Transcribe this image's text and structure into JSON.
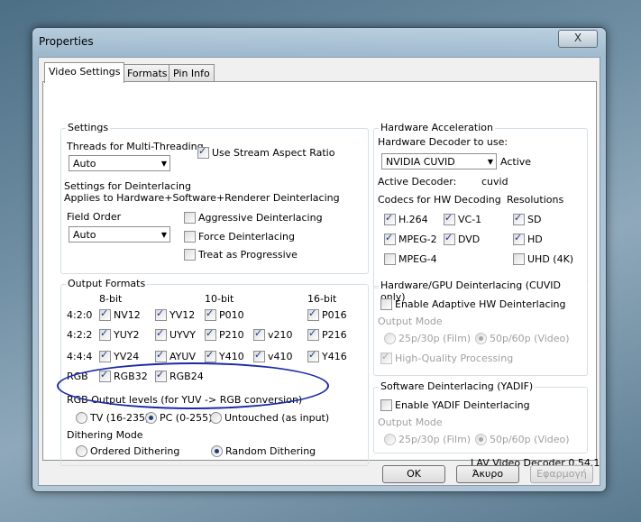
{
  "window": {
    "title": "Properties",
    "close": "X"
  },
  "tabs": [
    "Video Settings",
    "Formats",
    "Pin Info"
  ],
  "settings": {
    "group": "Settings",
    "threads_label": "Threads for Multi-Threading",
    "threads_value": "Auto",
    "stream_aspect": "Use Stream Aspect Ratio",
    "deint_label": "Settings for Deinterlacing",
    "deint_applies": "Applies to Hardware+Software+Renderer Deinterlacing",
    "field_order_label": "Field Order",
    "field_order_value": "Auto",
    "aggressive": "Aggressive Deinterlacing",
    "force": "Force Deinterlacing",
    "progressive": "Treat as Progressive"
  },
  "output": {
    "group": "Output Formats",
    "headers": [
      "8-bit",
      "10-bit",
      "16-bit"
    ],
    "rows": [
      "4:2:0",
      "4:2:2",
      "4:4:4",
      "RGB"
    ],
    "f": {
      "nv12": "NV12",
      "yv12": "YV12",
      "p010": "P010",
      "p016": "P016",
      "yuy2": "YUY2",
      "uyvy": "UYVY",
      "p210": "P210",
      "v210": "v210",
      "p216": "P216",
      "yv24": "YV24",
      "ayuv": "AYUV",
      "y410": "Y410",
      "v410": "v410",
      "y416": "Y416",
      "rgb32": "RGB32",
      "rgb24": "RGB24"
    },
    "levels_label": "RGB Output levels (for YUV -> RGB conversion)",
    "tv": "TV (16-235)",
    "pc": "PC (0-255)",
    "untouched": "Untouched (as input)",
    "dither_label": "Dithering Mode",
    "ordered": "Ordered Dithering",
    "random": "Random Dithering"
  },
  "hw": {
    "group": "Hardware Acceleration",
    "decoder_label": "Hardware Decoder to use:",
    "decoder_value": "NVIDIA CUVID",
    "active": "Active",
    "active_decoder_label": "Active Decoder:",
    "active_decoder_value": "cuvid",
    "codecs_label": "Codecs for HW Decoding",
    "resolutions_label": "Resolutions",
    "h264": "H.264",
    "vc1": "VC-1",
    "mpeg2": "MPEG-2",
    "dvd": "DVD",
    "mpeg4": "MPEG-4",
    "sd": "SD",
    "hd": "HD",
    "uhd": "UHD (4K)"
  },
  "gpu_deint": {
    "group": "Hardware/GPU Deinterlacing (CUVID only)",
    "enable": "Enable Adaptive HW Deinterlacing",
    "mode_label": "Output Mode",
    "film": "25p/30p (Film)",
    "video": "50p/60p (Video)",
    "hq": "High-Quality Processing"
  },
  "sw_deint": {
    "group": "Software Deinterlacing (YADIF)",
    "enable": "Enable YADIF Deinterlacing",
    "mode_label": "Output Mode",
    "film": "25p/30p (Film)",
    "video": "50p/60p (Video)"
  },
  "version": "LAV Video Decoder 0.54.1",
  "buttons": {
    "ok": "OK",
    "cancel": "Άκυρο",
    "apply": "Εφαρμογή"
  }
}
